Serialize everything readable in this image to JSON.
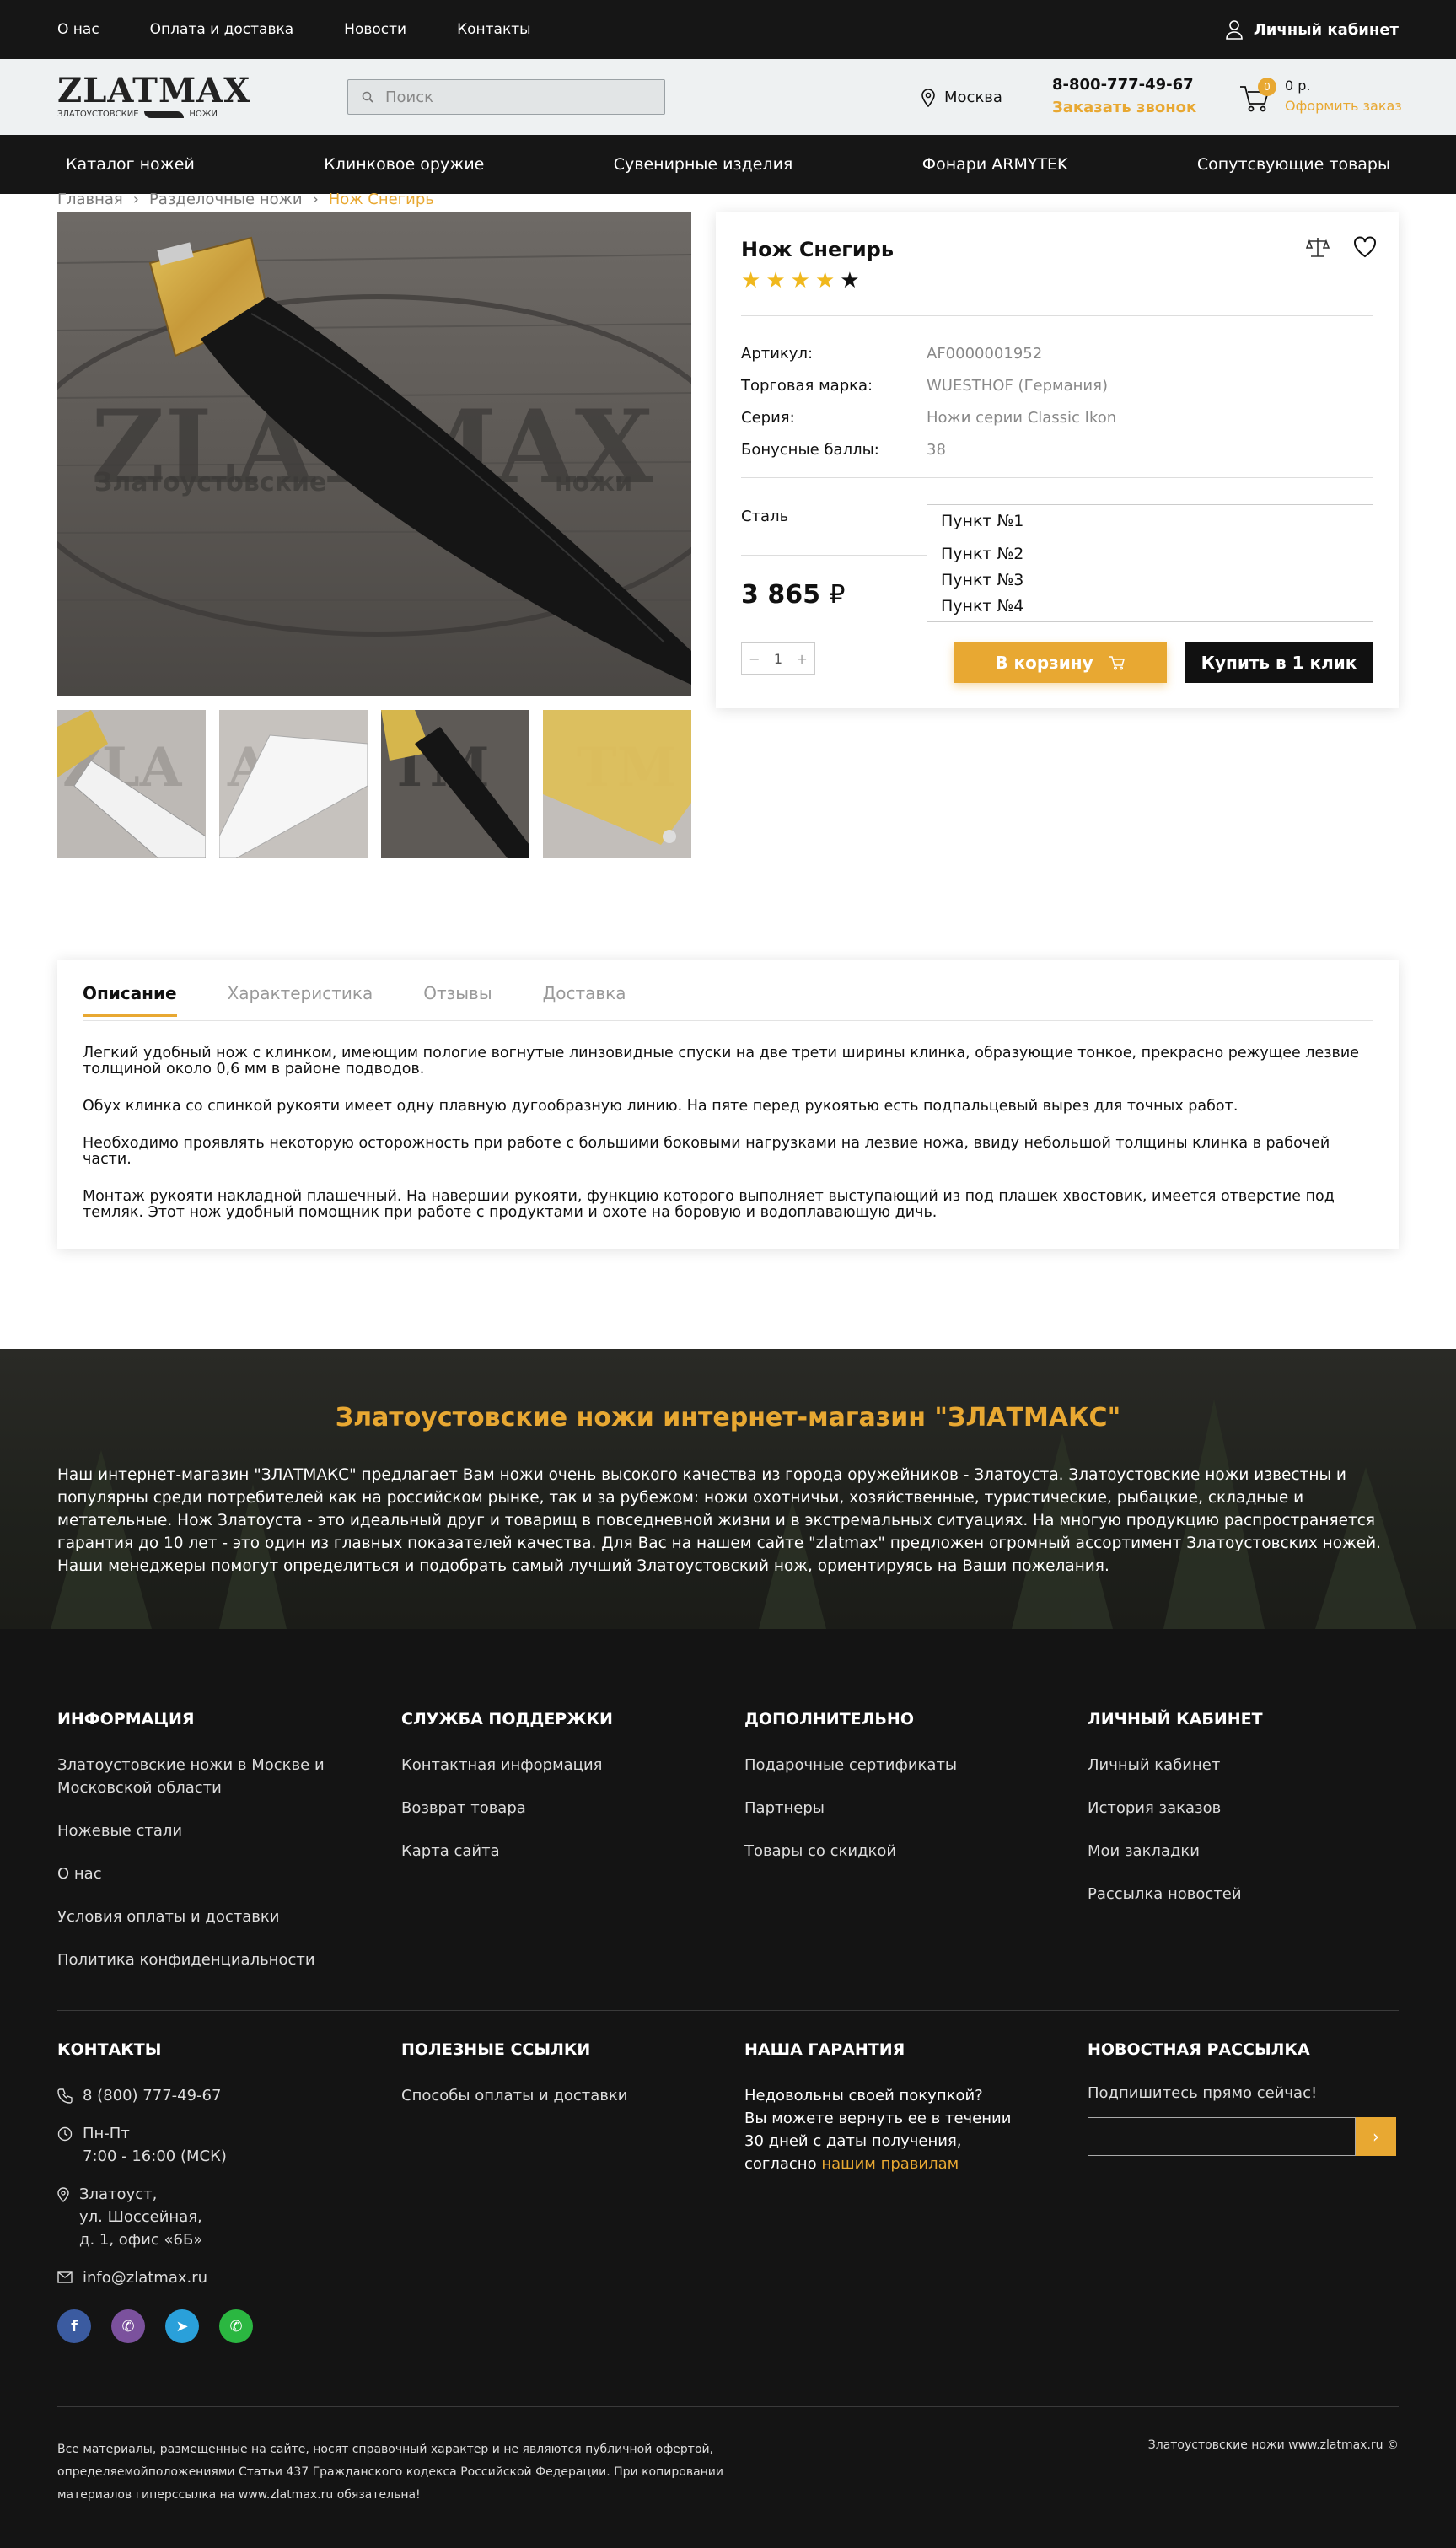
{
  "topbar": {
    "links": [
      "О нас",
      "Оплата и доставка",
      "Новости",
      "Контакты"
    ],
    "cabinet": "Личный кабинет"
  },
  "header": {
    "logo_text": "ZLATMAX",
    "logo_sub_left": "ЗЛАТОУСТОВСКИЕ",
    "logo_sub_right": "НОЖИ",
    "search_placeholder": "Поиск",
    "city": "Москва",
    "phone": "8-800-777-49-67",
    "callback": "Заказать звонок",
    "cart_count": "0",
    "cart_sum": "0 р.",
    "checkout": "Оформить заказ"
  },
  "nav": [
    "Каталог ножей",
    "Клинковое оружие",
    "Сувенирные изделия",
    "Фонари ARMYTEK",
    "Сопутсвующие товары"
  ],
  "breadcrumb": [
    "Главная",
    "Разделочные ножи",
    "Нож Снегирь"
  ],
  "product": {
    "title": "Нож Снегирь",
    "rating": 4,
    "rating_max": 5,
    "props": [
      {
        "k": "Артикул:",
        "v": "AF0000001952"
      },
      {
        "k": "Торговая марка:",
        "v": "WUESTHOF (Германия)"
      },
      {
        "k": "Серия:",
        "v": "Ножи серии Classic Ikon"
      },
      {
        "k": "Бонусные баллы:",
        "v": "38"
      }
    ],
    "steel_label": "Сталь",
    "steel_options": [
      "Пункт №1",
      "Пункт №2",
      "Пункт №3",
      "Пункт №4"
    ],
    "price": "3 865",
    "currency": "₽",
    "qty": "1",
    "qty_minus": "−",
    "qty_plus": "+",
    "to_cart": "В корзину",
    "buy_one_click": "Купить в 1 клик",
    "image_watermark": "ZLATMAX",
    "image_watermark_left": "Златоустовские",
    "image_watermark_right": "ножи"
  },
  "tabs": [
    "Описание",
    "Характеристика",
    "Отзывы",
    "Доставка"
  ],
  "description": [
    "Легкий удобный нож с клинком, имеющим пологие вогнутые линзовидные спуски на две трети ширины клинка, образующие тонкое, прекрасно режущее лезвие толщиной около 0,6 мм в районе подводов.",
    "Обух клинка со спинкой рукояти имеет одну плавную дугообразную линию. На пяте перед рукоятью есть подпальцевый вырез для точных работ.",
    "Необходимо проявлять некоторую осторожность при работе с большими боковыми нагрузками на лезвие ножа, ввиду небольшой толщины клинка в рабочей части.",
    "Монтаж рукояти накладной плашечный. На навершии рукояти, функцию которого выполняет выступающий из под плашек хвостовик, имеется отверстие под темляк. Этот нож удобный помощник при работе с продуктами и охоте на боровую и водоплавающую дичь."
  ],
  "about": {
    "heading": "Златоустовские ножи интернет-магазин \"ЗЛАТМАКС\"",
    "text": "Наш интернет-магазин \"ЗЛАТМАКС\" предлагает Вам ножи очень высокого качества из города оружейников - Златоуста. Златоустовские ножи известны и популярны среди потребителей как на российском рынке, так и за рубежом: ножи охотничьи, хозяйственные, туристические, рыбацкие, складные и метательные. Нож Златоуста - это идеальный друг и товарищ в повседневной жизни и в экстремальных ситуациях. На многую продукцию распространяется гарантия до 10 лет - это один из главных показателей качества. Для Вас на нашем сайте \"zlatmax\" предложен огромный ассортимент Златоустовских ножей. Наши менеджеры помогут определиться и подобрать самый лучший Златоустовский нож, ориентируясь на Ваши пожелания."
  },
  "footer": {
    "info": {
      "title": "Информация",
      "items": [
        "Златоустовские ножи в Москве и Московской области",
        "Ножевые стали",
        "О нас",
        "Условия оплаты и доставки",
        "Политика конфиденциальности"
      ]
    },
    "support": {
      "title": "Служба поддержки",
      "items": [
        "Контактная информация",
        "Возврат товара",
        "Карта сайта"
      ]
    },
    "extra": {
      "title": "Дополнительно",
      "items": [
        "Подарочные сертификаты",
        "Партнеры",
        "Товары со скидкой"
      ]
    },
    "account": {
      "title": "Личный кабинет",
      "items": [
        "Личный кабинет",
        "История заказов",
        "Мои закладки",
        "Рассылка новостей"
      ]
    },
    "contacts": {
      "title": "Контакты",
      "phone": "8 (800) 777-49-67",
      "hours_days": "Пн-Пт",
      "hours_time": "7:00 - 16:00 (МСК)",
      "addr1": "Златоуст,",
      "addr2": "ул. Шоссейная,",
      "addr3": "д. 1, офис «6Б»",
      "email": "info@zlatmax.ru"
    },
    "useful": {
      "title": "Полезные ссылки",
      "items": [
        "Способы оплаты и доставки"
      ]
    },
    "guarantee": {
      "title": "Наша гарантия",
      "line1": "Недовольны своей покупкой?",
      "line2": "Вы можете вернуть ее в течении",
      "line3": "30 дней с даты получения,",
      "line4_pre": "согласно ",
      "line4_link": "нашим правилам"
    },
    "newsletter": {
      "title": "Новостная рассылка",
      "text": "Подпишитесь прямо сейчас!"
    },
    "copyright": "Все материалы, размещенные на сайте, носят справочный характер и не являются публичной офертой, определяемойположениями Статьи 437 Гражданского кодекса Российской Федерации. При копировании материалов гиперссылка на www.zlatmax.ru обязательна!",
    "copyright_right": "Златоустовские ножи www.zlatmax.ru ©"
  },
  "colors": {
    "accent": "#e8a832",
    "dark": "#161616",
    "footer": "#141414"
  }
}
